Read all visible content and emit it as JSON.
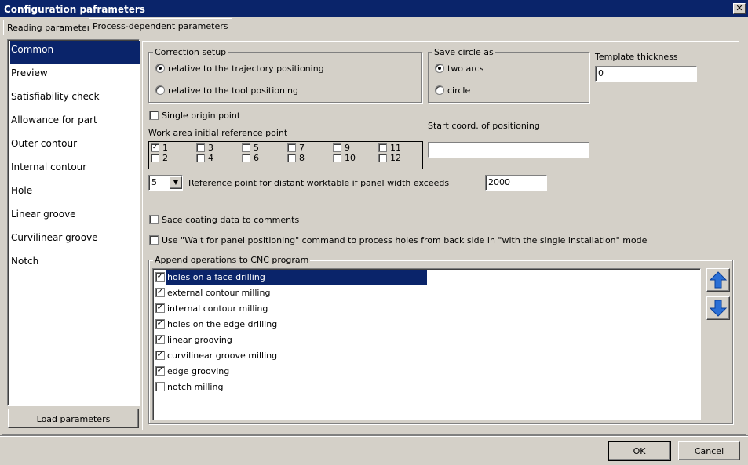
{
  "window": {
    "title": "Configuration paframeters",
    "close_label": "✕"
  },
  "tabs": [
    "Reading parameters",
    "Process-dependent parameters"
  ],
  "nav": [
    "Common",
    "Preview",
    "Satisfiability check",
    "Allowance for part",
    "Outer contour",
    "Internal contour",
    "Hole",
    "Linear groove",
    "Curvilinear groove",
    "Notch"
  ],
  "load_button": "Load parameters",
  "correction": {
    "legend": "Correction setup",
    "opt1": "relative to the trajectory positioning",
    "opt2": "relative to the tool positioning",
    "selected": 1
  },
  "save_circle": {
    "legend": "Save circle as",
    "opt1": "two arcs",
    "opt2": "circle",
    "selected": 1
  },
  "template": {
    "label": "Template thickness",
    "value": "0"
  },
  "single_origin": {
    "label": "Single origin point",
    "checked": false
  },
  "work_area": {
    "label": "Work area initial reference point",
    "items": [
      "1",
      "3",
      "5",
      "7",
      "9",
      "11",
      "2",
      "4",
      "6",
      "8",
      "10",
      "12"
    ],
    "checked": "1"
  },
  "start_coord": {
    "label": "Start coord. of positioning",
    "value": ""
  },
  "distant": {
    "select_value": "5",
    "label": "Reference point for distant worktable if panel width exceeds",
    "value": "2000"
  },
  "sace_coating": {
    "label": "Sace coating data to comments",
    "checked": false
  },
  "wait_cmd": {
    "label": "Use \"Wait for panel positioning\" command to process holes from back side in \"with the single installation\" mode",
    "checked": false
  },
  "append": {
    "legend": "Append operations to CNC program",
    "items": [
      {
        "label": "holes on a face drilling",
        "checked": true,
        "selected": true
      },
      {
        "label": "external contour milling",
        "checked": true
      },
      {
        "label": "internal contour milling",
        "checked": true
      },
      {
        "label": "holes on the edge drilling",
        "checked": true
      },
      {
        "label": "linear grooving",
        "checked": true
      },
      {
        "label": "curvilinear groove milling",
        "checked": true
      },
      {
        "label": "edge grooving",
        "checked": true
      },
      {
        "label": "notch milling",
        "checked": false
      }
    ]
  },
  "buttons": {
    "ok": "OK",
    "cancel": "Cancel"
  },
  "icons": {
    "up": "arrow-up-icon",
    "down": "arrow-down-icon",
    "accent": "#0a246a",
    "arrow_color": "#2a6fd6"
  }
}
